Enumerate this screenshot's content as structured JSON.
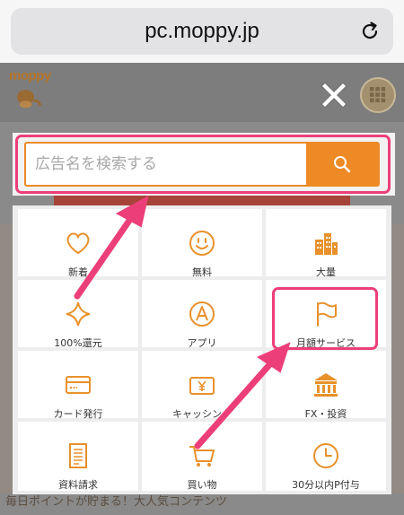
{
  "browser": {
    "url": "pc.moppy.jp"
  },
  "site": {
    "logo_text": "moppy",
    "bottom_text": "毎日ポイントが貯まる！大人気コンテンツ"
  },
  "search": {
    "placeholder": "広告名を検索する"
  },
  "categories": [
    {
      "label": "新着",
      "icon": "heart-icon"
    },
    {
      "label": "無料",
      "icon": "smile-icon"
    },
    {
      "label": "大量",
      "icon": "buildings-icon"
    },
    {
      "label": "100%還元",
      "icon": "sparkle-icon"
    },
    {
      "label": "アプリ",
      "icon": "app-a-icon"
    },
    {
      "label": "月額サービス",
      "icon": "flag-icon"
    },
    {
      "label": "カード発行",
      "icon": "credit-card-icon"
    },
    {
      "label": "キャッシング",
      "icon": "yen-wallet-icon"
    },
    {
      "label": "FX・投資",
      "icon": "bank-icon"
    },
    {
      "label": "資料請求",
      "icon": "document-icon"
    },
    {
      "label": "買い物",
      "icon": "shopping-cart-icon"
    },
    {
      "label": "30分以内P付与",
      "icon": "clock-icon"
    }
  ],
  "colors": {
    "accent": "#ed8a26",
    "highlight": "#ec3f7a",
    "icon": "#e8912b"
  }
}
